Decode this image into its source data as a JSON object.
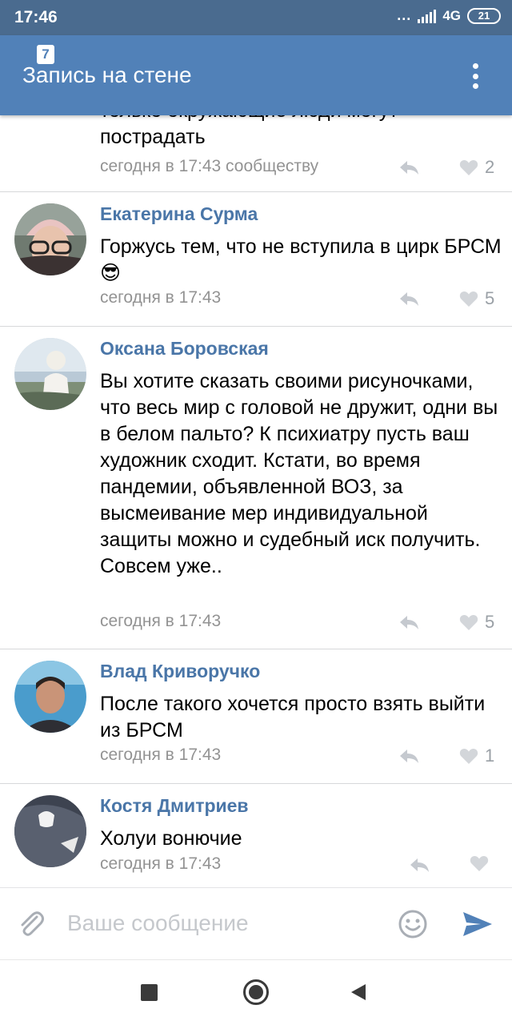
{
  "status_bar": {
    "time": "17:46",
    "dots": "...",
    "network": "4G",
    "battery": "21"
  },
  "toolbar": {
    "badge": "7",
    "title": "Запись на стене"
  },
  "comments": [
    {
      "text": "только окружающие люди могут пострадать",
      "meta": "сегодня в 17:43 сообществу",
      "likes": "2"
    },
    {
      "author": "Екатерина Сурма",
      "text": "Горжусь тем, что не вступила в цирк БРСМ😎",
      "meta": "сегодня в 17:43",
      "likes": "5"
    },
    {
      "author": "Оксана Боровская",
      "text": "Вы хотите сказать своими рисуночками, что весь мир с головой не дружит, одни вы в белом пальто? К психиатру пусть ваш художник сходит. Кстати, во время пандемии, объявленной ВОЗ, за высмеивание мер индивидуальной защиты можно и судебный иск получить. Совсем уже..",
      "meta": "сегодня в 17:43",
      "likes": "5"
    },
    {
      "author": "Влад Криворучко",
      "text": "После такого хочется просто взять выйти из  БРСМ",
      "meta": "сегодня в 17:43",
      "likes": "1"
    },
    {
      "author": "Костя Дмитриев",
      "text": "Холуи вонючие",
      "meta": "сегодня в 17:43",
      "likes": ""
    }
  ],
  "composer": {
    "placeholder": "Ваше сообщение"
  },
  "icons": {
    "attach": "paperclip-icon",
    "emoji": "smile-icon",
    "send": "send-icon",
    "reply": "reply-arrow-icon",
    "like": "heart-icon",
    "menu": "more-vert-icon"
  },
  "colors": {
    "status_bar": "#4a6b8f",
    "toolbar": "#5181b8",
    "author_name": "#4a76a8",
    "meta": "#939393",
    "send": "#5181b8"
  }
}
